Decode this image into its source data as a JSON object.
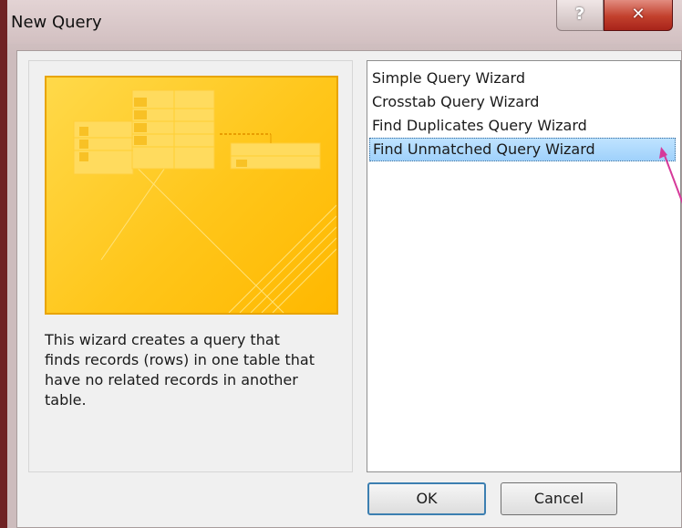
{
  "window": {
    "title": "New Query",
    "help_label": "?",
    "close_label": "✕"
  },
  "description": "This wizard creates a query that finds records (rows) in one table that have no related records in another table.",
  "wizards": [
    {
      "label": "Simple Query Wizard",
      "selected": false
    },
    {
      "label": "Crosstab Query Wizard",
      "selected": false
    },
    {
      "label": "Find Duplicates Query Wizard",
      "selected": false
    },
    {
      "label": "Find Unmatched Query Wizard",
      "selected": true
    }
  ],
  "buttons": {
    "ok_label": "OK",
    "cancel_label": "Cancel"
  },
  "colors": {
    "selection": "#9fd1fb",
    "preview_background": "#ffc61a",
    "annotation_arrow": "#d63a9a"
  }
}
